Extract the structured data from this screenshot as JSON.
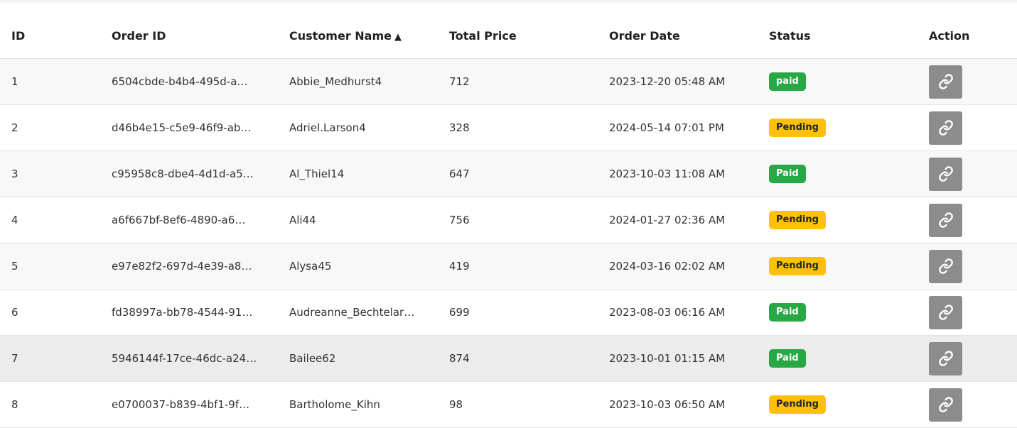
{
  "table": {
    "headers": {
      "id": "ID",
      "order_id": "Order ID",
      "customer_name": "Customer Name",
      "sort_indicator": "▲",
      "total_price": "Total Price",
      "order_date": "Order Date",
      "status": "Status",
      "action": "Action"
    },
    "rows": [
      {
        "id": "1",
        "order_id": "6504cbde-b4b4-495d-a…",
        "customer": "Abbie_Medhurst4",
        "price": "712",
        "date": "2023-12-20 05:48 AM",
        "status": "paid",
        "status_type": "paid"
      },
      {
        "id": "2",
        "order_id": "d46b4e15-c5e9-46f9-ab…",
        "customer": "Adriel.Larson4",
        "price": "328",
        "date": "2024-05-14 07:01 PM",
        "status": "Pending",
        "status_type": "pending"
      },
      {
        "id": "3",
        "order_id": "c95958c8-dbe4-4d1d-a5…",
        "customer": "Al_Thiel14",
        "price": "647",
        "date": "2023-10-03 11:08 AM",
        "status": "Paid",
        "status_type": "paid"
      },
      {
        "id": "4",
        "order_id": "a6f667bf-8ef6-4890-a6…",
        "customer": "Ali44",
        "price": "756",
        "date": "2024-01-27 02:36 AM",
        "status": "Pending",
        "status_type": "pending"
      },
      {
        "id": "5",
        "order_id": "e97e82f2-697d-4e39-a8…",
        "customer": "Alysa45",
        "price": "419",
        "date": "2024-03-16 02:02 AM",
        "status": "Pending",
        "status_type": "pending"
      },
      {
        "id": "6",
        "order_id": "fd38997a-bb78-4544-91…",
        "customer": "Audreanne_Bechtelar…",
        "price": "699",
        "date": "2023-08-03 06:16 AM",
        "status": "Paid",
        "status_type": "paid"
      },
      {
        "id": "7",
        "order_id": "5946144f-17ce-46dc-a24…",
        "customer": "Bailee62",
        "price": "874",
        "date": "2023-10-01 01:15 AM",
        "status": "Paid",
        "status_type": "paid"
      },
      {
        "id": "8",
        "order_id": "e0700037-b839-4bf1-9f…",
        "customer": "Bartholome_Kihn",
        "price": "98",
        "date": "2023-10-03 06:50 AM",
        "status": "Pending",
        "status_type": "pending"
      }
    ]
  },
  "icons": {
    "action": "link-icon"
  },
  "colors": {
    "paid_badge": "#28a745",
    "pending_badge": "#ffc107",
    "action_button": "#8c8c8c"
  }
}
